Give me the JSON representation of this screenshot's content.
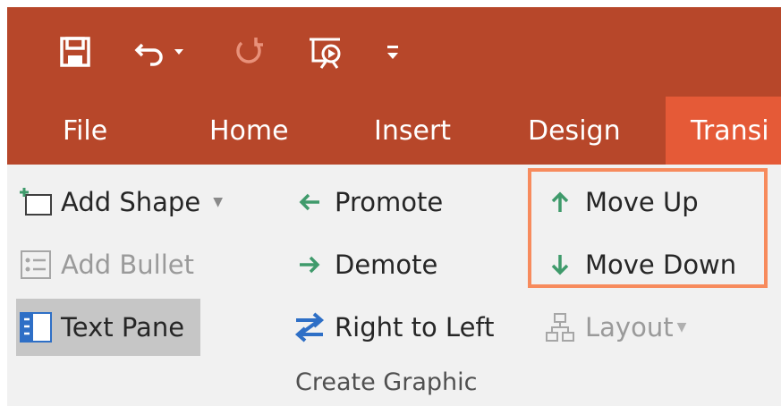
{
  "quick_access": {
    "buttons": [
      {
        "icon": "save-icon"
      },
      {
        "icon": "undo-icon"
      },
      {
        "icon": "undo-dropdown-icon"
      },
      {
        "icon": "redo-icon"
      },
      {
        "icon": "start-from-beginning-icon"
      },
      {
        "icon": "customize-quick-access-icon"
      }
    ]
  },
  "tabs": [
    {
      "label": "File"
    },
    {
      "label": "Home"
    },
    {
      "label": "Insert"
    },
    {
      "label": "Design"
    },
    {
      "label": "Transi",
      "active": true
    }
  ],
  "ribbon": {
    "add_shape": "Add Shape",
    "add_bullet": "Add Bullet",
    "text_pane": "Text Pane",
    "promote": "Promote",
    "demote": "Demote",
    "right_to_left": "Right to Left",
    "layout": "Layout",
    "move_up": "Move Up",
    "move_down": "Move Down",
    "group_label": "Create Graphic"
  },
  "colors": {
    "title_bar": "#b7472a",
    "active_tab": "#e55a37",
    "ribbon_bg": "#f1f1f1",
    "highlight_border": "#f78b5d",
    "green_arrow": "#3f9a6b",
    "blue_arrow": "#2e6fc6"
  }
}
